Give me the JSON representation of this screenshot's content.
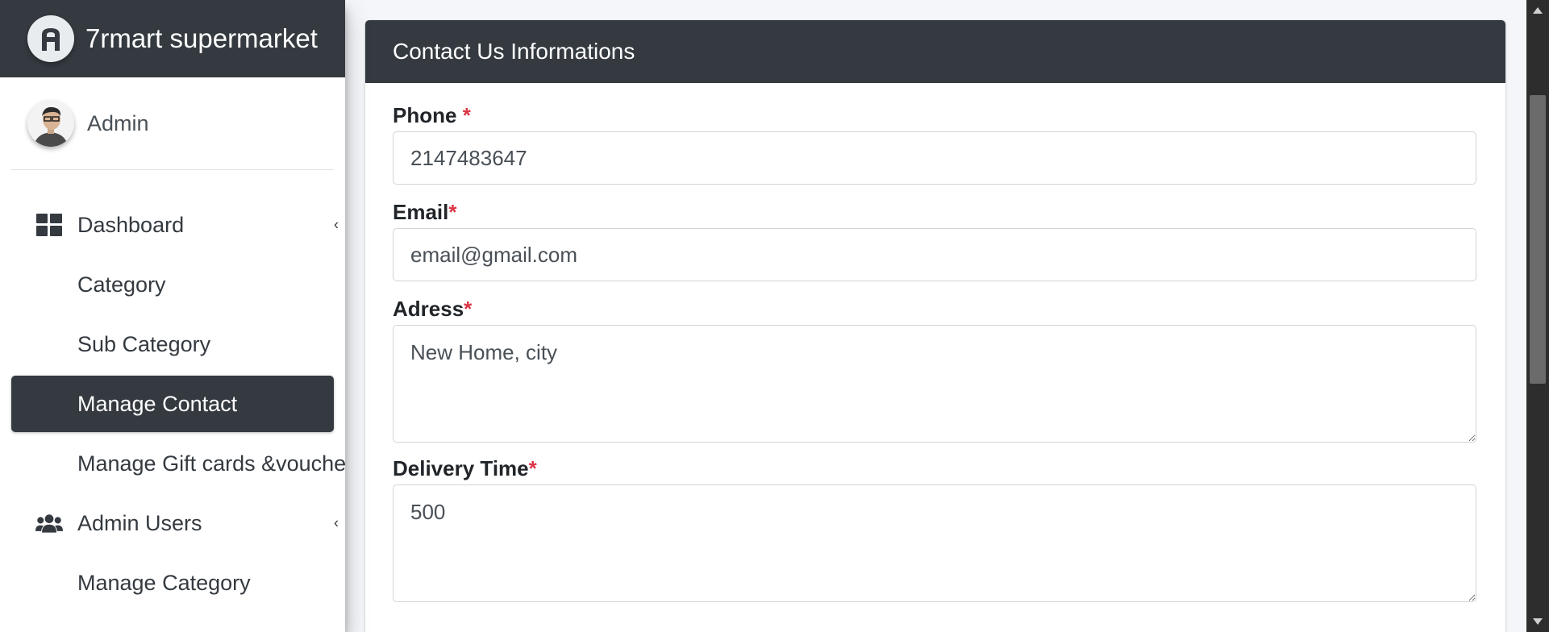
{
  "brand": {
    "title": "7rmart supermarket",
    "logo_icon": "admin-lte-logo-icon"
  },
  "user": {
    "name": "Admin",
    "avatar_icon": "user-avatar"
  },
  "nav": {
    "dashboard": "Dashboard",
    "category": "Category",
    "sub_category": "Sub Category",
    "manage_contact": "Manage Contact",
    "gift_cards": "Manage Gift cards &voucher",
    "admin_users": "Admin Users",
    "manage_category": "Manage Category",
    "caret": "‹"
  },
  "card": {
    "title": "Contact Us Informations",
    "fields": {
      "phone": {
        "label": "Phone",
        "required": "*",
        "value": "2147483647"
      },
      "email": {
        "label": "Email",
        "required": "*",
        "value": "email@gmail.com"
      },
      "address": {
        "label": "Adress",
        "required": "*",
        "value": "New Home, city"
      },
      "delivery_time": {
        "label": "Delivery Time",
        "required": "*",
        "value": "500"
      }
    }
  },
  "colors": {
    "dark": "#343a40",
    "required": "#dc3545",
    "background": "#f4f6f9"
  }
}
